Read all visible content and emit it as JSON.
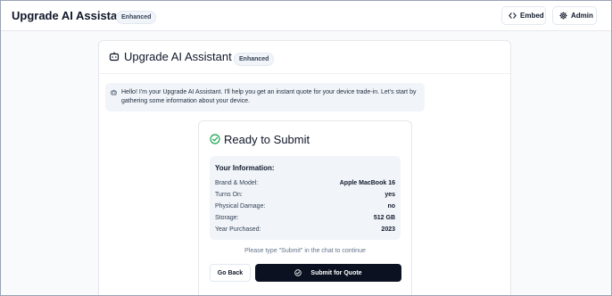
{
  "header": {
    "title": "Upgrade AI Assistant",
    "badge": "Enhanced",
    "embed_label": "Embed",
    "admin_label": "Admin"
  },
  "card": {
    "title": "Upgrade AI Assistant",
    "badge": "Enhanced"
  },
  "assistant_message": "Hello! I'm your Upgrade AI Assistant. I'll help you get an instant quote for your device trade-in. Let's start by gathering some information about your device.",
  "submit_panel": {
    "title": "Ready to Submit",
    "info_heading": "Your Information:",
    "rows": [
      {
        "label": "Brand & Model:",
        "value": "Apple MacBook 16"
      },
      {
        "label": "Turns On:",
        "value": "yes"
      },
      {
        "label": "Physical Damage:",
        "value": "no"
      },
      {
        "label": "Storage:",
        "value": "512 GB"
      },
      {
        "label": "Year Purchased:",
        "value": "2023"
      }
    ],
    "hint": "Please type \"Submit\" in the chat to continue",
    "go_back_label": "Go Back",
    "submit_label": "Submit for Quote"
  },
  "colors": {
    "accent_green": "#16a34a",
    "primary_dark": "#0b1120"
  },
  "icons": [
    "code-icon",
    "gear-icon",
    "bot-icon",
    "check-circle-icon"
  ]
}
